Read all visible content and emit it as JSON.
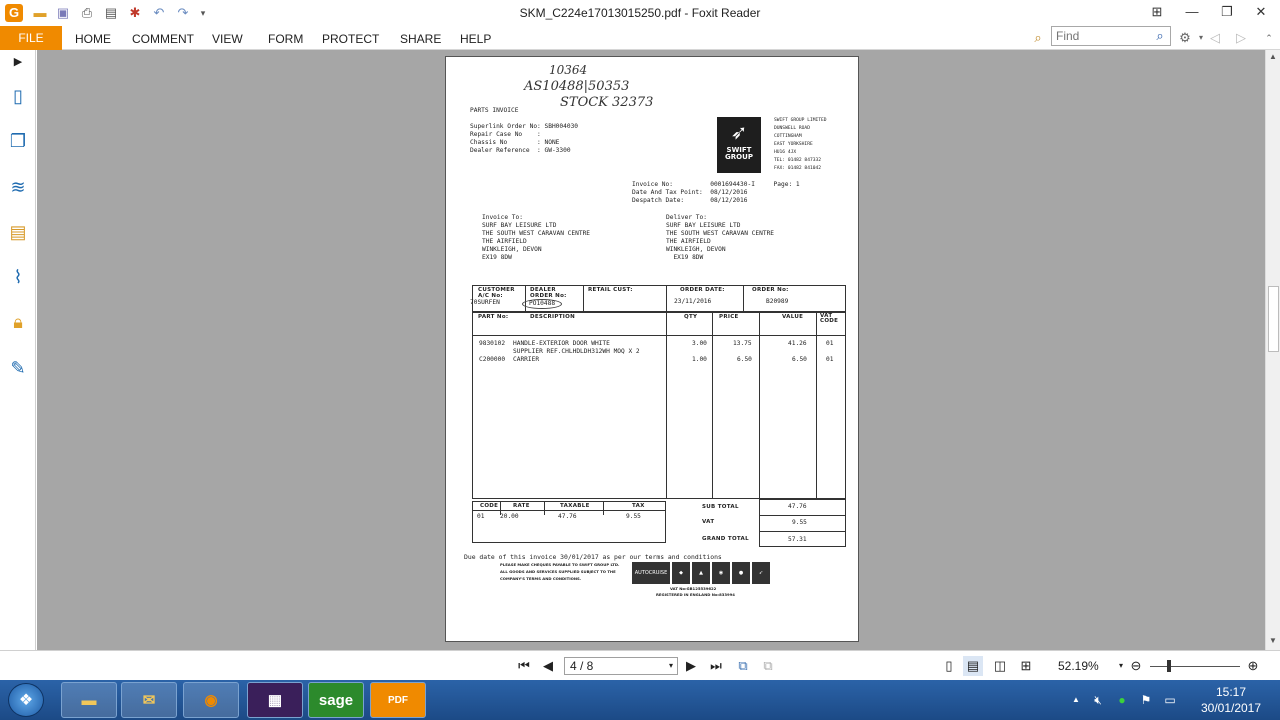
{
  "window": {
    "title": "SKM_C224e17013015250.pdf - Foxit Reader",
    "app_icon": "G",
    "quick_access": [
      "open-icon",
      "save-icon",
      "print-icon",
      "properties-icon",
      "snapshot-icon",
      "undo-icon",
      "redo-icon",
      "customize-icon"
    ]
  },
  "ribbon": {
    "file": "FILE",
    "tabs": [
      "HOME",
      "COMMENT",
      "VIEW",
      "FORM",
      "PROTECT",
      "SHARE",
      "HELP"
    ],
    "find_placeholder": "Find"
  },
  "document": {
    "handwritten": [
      "10364",
      "AS10488|50353",
      "STOCK 32373"
    ],
    "heading": "PARTS INVOICE",
    "refs": [
      "Superlink Order No: SBH004030",
      "Repair Case No    :",
      "Chassis No        : NONE",
      "Dealer Reference  : GW-3300"
    ],
    "company": {
      "logo_text": "SWIFT\nGROUP",
      "lines": [
        "SWIFT GROUP LIMITED",
        "DUNSWELL ROAD",
        "COTTINGHAM",
        "EAST YORKSHIRE",
        "HU16 4JX",
        "TEL: 01482 847332",
        "FAX: 01482 841042"
      ]
    },
    "invoice_meta": [
      "Invoice No:          0001694430-I     Page: 1",
      "Date And Tax Point:  08/12/2016",
      "Despatch Date:       08/12/2016"
    ],
    "invoice_to": [
      "Invoice To:",
      "SURF BAY LEISURE LTD",
      "THE SOUTH WEST CARAVAN CENTRE",
      "THE AIRFIELD",
      "WINKLEIGH, DEVON",
      "EX19 8DW"
    ],
    "deliver_to": [
      "Deliver To:",
      "SURF BAY LEISURE LTD",
      "THE SOUTH WEST CARAVAN CENTRE",
      "THE AIRFIELD",
      "WINKLEIGH, DEVON",
      "  EX19 8DW"
    ],
    "order_headers": {
      "customer": "CUSTOMER\nA/C No:",
      "dealer": "DEALER\nORDER No:",
      "retail": "RETAIL CUST:",
      "order_date": "ORDER DATE:",
      "order_no": "ORDER No:"
    },
    "order_values": {
      "customer": "70SURFEN",
      "dealer": "PO10488",
      "order_date": "23/11/2016",
      "order_no": "B20989"
    },
    "line_headers": {
      "part": "PART No:",
      "desc": "DESCRIPTION",
      "qty": "QTY",
      "price": "PRICE",
      "value": "VALUE",
      "vat": "VAT\nCODE"
    },
    "lines": [
      {
        "part": "9830102",
        "desc": "HANDLE-EXTERIOR DOOR WHITE",
        "qty": "3.00",
        "price": "13.75",
        "value": "41.26",
        "vat": "01"
      },
      {
        "part": "",
        "desc": "SUPPLIER REF.CHLHDLDH312WH MOQ X 2",
        "qty": "",
        "price": "",
        "value": "",
        "vat": ""
      },
      {
        "part": "C200000",
        "desc": "CARRIER",
        "qty": "1.00",
        "price": "6.50",
        "value": "6.50",
        "vat": "01"
      }
    ],
    "tax_headers": {
      "code": "CODE",
      "rate": "RATE",
      "taxable": "TAXABLE",
      "tax": "TAX"
    },
    "tax_values": {
      "code": "01",
      "rate": "20.00",
      "taxable": "47.76",
      "tax": "9.55"
    },
    "totals": [
      {
        "label": "SUB TOTAL",
        "value": "47.76"
      },
      {
        "label": "VAT",
        "value": "9.55"
      },
      {
        "label": "GRAND TOTAL",
        "value": "57.31"
      }
    ],
    "due_note": "Due date of this invoice 30/01/2017 as per our terms and conditions",
    "small_print": [
      "PLEASE MAKE CHEQUES PAYABLE TO SWIFT GROUP LTD.",
      "ALL GOODS AND SERVICES SUPPLIED SUBJECT TO THE",
      "COMPANY'S TERMS AND CONDITIONS."
    ],
    "brands": [
      "AUTOCRUISE"
    ],
    "vat_no": "VAT No:GB125539622",
    "registered": "REGISTERED IN ENGLAND No:833994"
  },
  "statusbar": {
    "page": "4 / 8",
    "zoom": "52.19%"
  },
  "taskbar": {
    "apps": [
      "explorer",
      "outlook",
      "firefox",
      "calculator-app",
      "sage",
      "foxit-pdf"
    ],
    "sage_label": "sage",
    "pdf_label": "PDF",
    "time": "15:17",
    "date": "30/01/2017"
  }
}
